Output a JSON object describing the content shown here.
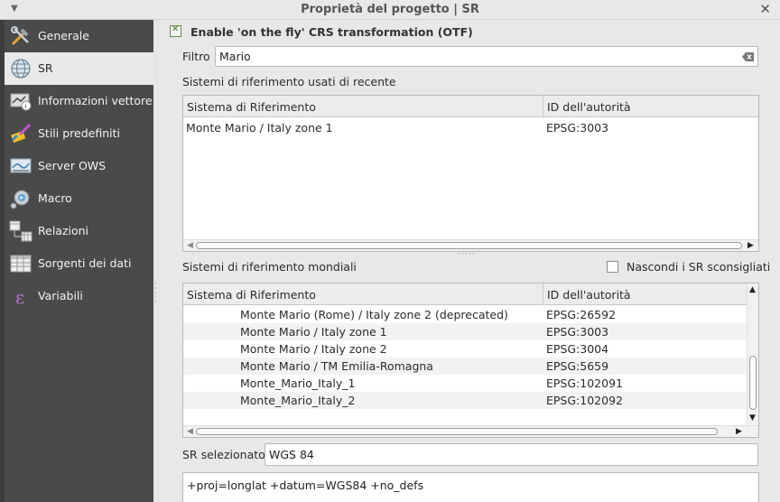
{
  "window": {
    "title": "Proprietà del progetto | SR"
  },
  "sidebar": {
    "items": [
      {
        "label": "Generale",
        "icon": "tools-icon",
        "active": false
      },
      {
        "label": "SR",
        "icon": "globe-icon",
        "active": true
      },
      {
        "label": "Informazioni vettore",
        "icon": "vector-info-icon",
        "active": false
      },
      {
        "label": "Stili predefiniti",
        "icon": "paintbrush-icon",
        "active": false
      },
      {
        "label": "Server OWS",
        "icon": "ows-server-icon",
        "active": false
      },
      {
        "label": "Macro",
        "icon": "macro-gear-icon",
        "active": false
      },
      {
        "label": "Relazioni",
        "icon": "relations-icon",
        "active": false
      },
      {
        "label": "Sorgenti dei dati",
        "icon": "data-table-icon",
        "active": false
      },
      {
        "label": "Variabili",
        "icon": "variable-icon",
        "active": false
      }
    ]
  },
  "crs": {
    "otf_label": "Enable 'on the fly' CRS transformation (OTF)",
    "otf_checked": true,
    "filter_label": "Filtro",
    "filter_value": "Mario",
    "recent": {
      "label": "Sistemi di riferimento usati di recente",
      "columns": [
        "Sistema di Riferimento",
        "ID dell'autorità"
      ],
      "rows": [
        {
          "name": "Monte Mario / Italy zone 1",
          "id": "EPSG:3003"
        }
      ]
    },
    "world": {
      "label": "Sistemi di riferimento mondiali",
      "hide_deprecated_label": "Nascondi i SR sconsigliati",
      "hide_deprecated_checked": false,
      "columns": [
        "Sistema di Riferimento",
        "ID dell'autorità"
      ],
      "rows": [
        {
          "name": "Monte Mario (Rome) / Italy zone 2 (deprecated)",
          "id": "EPSG:26592"
        },
        {
          "name": "Monte Mario / Italy zone 1",
          "id": "EPSG:3003"
        },
        {
          "name": "Monte Mario / Italy zone 2",
          "id": "EPSG:3004"
        },
        {
          "name": "Monte Mario / TM Emilia-Romagna",
          "id": "EPSG:5659"
        },
        {
          "name": "Monte_Mario_Italy_1",
          "id": "EPSG:102091"
        },
        {
          "name": "Monte_Mario_Italy_2",
          "id": "EPSG:102092"
        }
      ]
    },
    "selected_label": "SR selezionato:",
    "selected_value": "WGS 84",
    "proj_string": "+proj=longlat +datum=WGS84 +no_defs"
  },
  "colors": {
    "sidebar_bg": "#4a4a4a",
    "sidebar_active": "#e9e9e9",
    "panel_bg": "#e8e8e8",
    "checkbox_accent": "#3e7a22"
  }
}
